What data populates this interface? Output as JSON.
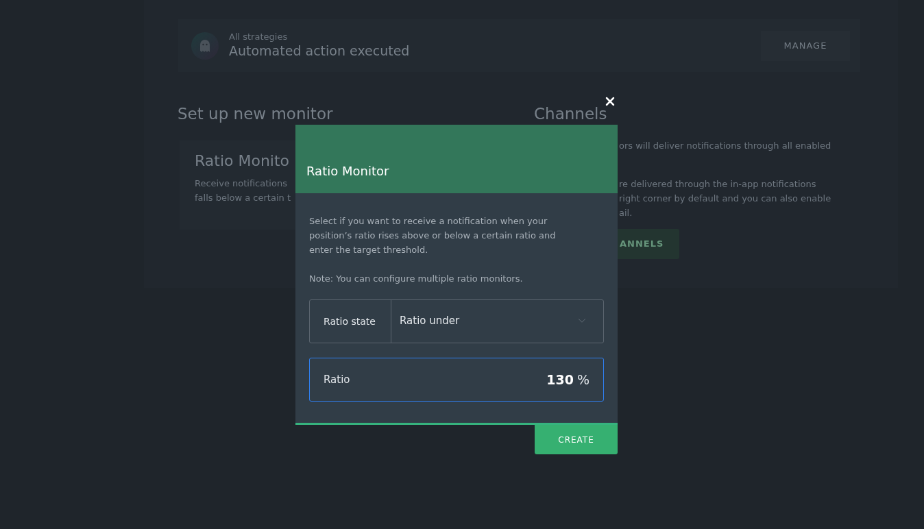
{
  "background": {
    "strategy_card": {
      "subtitle": "All strategies",
      "title": "Automated action executed",
      "button": "MANAGE"
    },
    "setup": {
      "heading": "Set up new monitor",
      "card": {
        "title": "Ratio Monito",
        "description_lines": [
          "Receive notifications",
          "falls below a certain t"
        ]
      }
    },
    "channels": {
      "heading": "Channels",
      "paragraphs": [
        [
          "ors will deliver notifications through all enabled"
        ],
        [
          "re delivered through the in-app notifications",
          "right corner by default and you can also enable",
          "ail."
        ]
      ],
      "button": "ANNELS"
    }
  },
  "modal": {
    "title": "Ratio Monitor",
    "description": "Select if you want to receive a notification when your position’s ratio rises above or below a certain ratio and enter the target threshold.",
    "note": "Note: You can configure multiple ratio monitors.",
    "select": {
      "label": "Ratio state",
      "value": "Ratio under"
    },
    "ratio_field": {
      "label": "Ratio",
      "value": "130",
      "unit": "%",
      "focused": true
    },
    "button": "CREATE"
  }
}
